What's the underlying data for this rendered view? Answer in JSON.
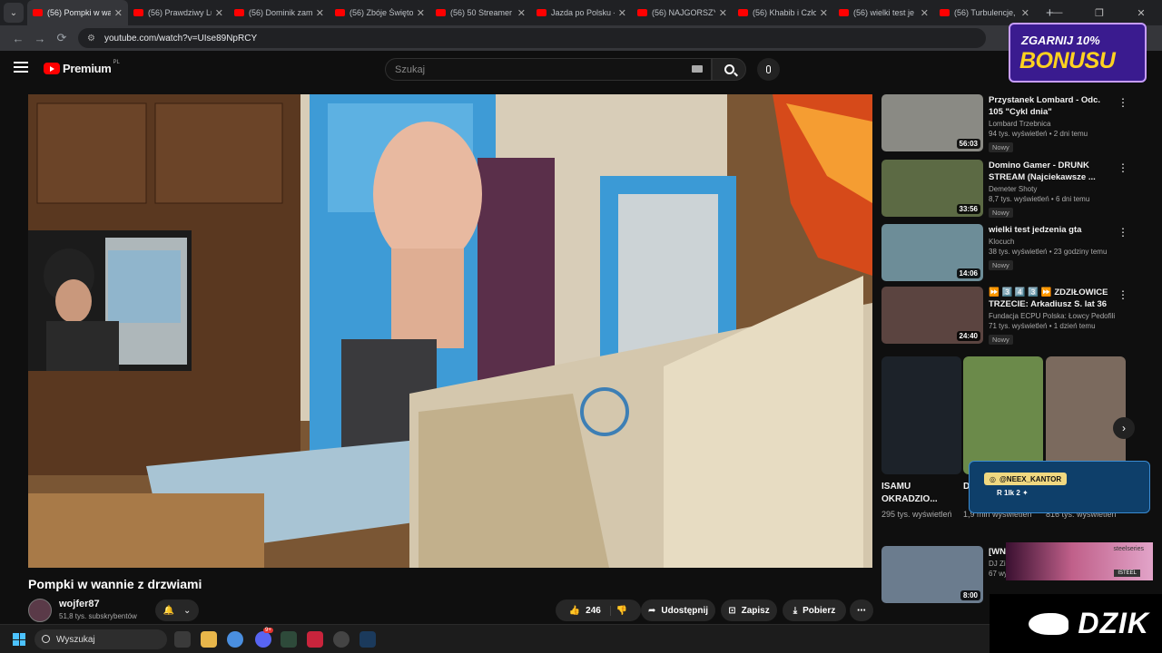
{
  "browser": {
    "tabs": [
      {
        "title": "(56) Pompki w wa",
        "active": true
      },
      {
        "title": "(56) Prawdziwy Lu",
        "active": false
      },
      {
        "title": "(56) Dominik zam",
        "active": false
      },
      {
        "title": "(56) Zbóje Święto",
        "active": false
      },
      {
        "title": "(56) 50 Streamer",
        "active": false
      },
      {
        "title": "Jazda po Polsku -",
        "active": false
      },
      {
        "title": "(56) NAJGORSZY",
        "active": false
      },
      {
        "title": "(56) Khabib i Czło",
        "active": false
      },
      {
        "title": "(56) wielki test je",
        "active": false
      },
      {
        "title": "(56) Turbulencje,",
        "active": false
      }
    ],
    "url": "youtube.com/watch?v=UIse89NpRCY"
  },
  "youtube": {
    "logo_text": "Premium",
    "logo_region": "PL",
    "search_placeholder": "Szukaj"
  },
  "video": {
    "title": "Pompki w wannie z drzwiami",
    "channel": "wojfer87",
    "subscribers": "51,8 tys. subskrybentów",
    "likes": "246",
    "share_label": "Udostępnij",
    "save_label": "Zapisz",
    "download_label": "Pobierz"
  },
  "recommendations": [
    {
      "title": "Przystanek Lombard - Odc. 105 \"Cykl dnia\"",
      "channel": "Lombard Trzebnica",
      "meta": "94 tys. wyświetleń • 2 dni temu",
      "badge": "Nowy",
      "duration": "56:03",
      "color": "#8a8a84"
    },
    {
      "title": "Domino Gamer - DRUNK STREAM (Najciekawsze ...",
      "channel": "Demeter Shoty",
      "meta": "8,7 tys. wyświetleń • 6 dni temu",
      "badge": "Nowy",
      "duration": "33:56",
      "color": "#5c6a44"
    },
    {
      "title": "wielki test jedzenia gta",
      "channel": "Klocuch",
      "meta": "38 tys. wyświetleń • 23 godziny temu",
      "badge": "Nowy",
      "duration": "14:06",
      "color": "#6d8d98"
    },
    {
      "title": "⏩ 3️⃣ 4️⃣ 3️⃣ ⏩ ZDZIŁOWICE TRZECIE: Arkadiusz S. lat 36",
      "channel": "Fundacja ECPU Polska: Łowcy Pedofili",
      "meta": "71 tys. wyświetleń • 1 dzień temu",
      "badge": "Nowy",
      "duration": "24:40",
      "color": "#5b4440"
    },
    {
      "title": "[WN] Tkac...",
      "channel": "DJ Zi...",
      "meta": "67 wyświetleń • 2 dni temu",
      "badge": "",
      "duration": "8:00",
      "color": "#6b7c8e"
    }
  ],
  "shorts": [
    {
      "title": "ISAMU OKRADZIO...",
      "views": "295 tys. wyświetleń",
      "color": "#1c2229"
    },
    {
      "title": "D... k...",
      "views": "1,9 mln wyświetleń",
      "color": "#6b8a4a"
    },
    {
      "title": "",
      "views": "816 tys. wyświetleń",
      "color": "#7b6a5e"
    }
  ],
  "taskbar": {
    "search_placeholder": "Wyszukaj",
    "discord_badge": "9+"
  },
  "stream_overlays": {
    "bonus_line1": "ZGARNIJ 10%",
    "bonus_line2": "BONUSU",
    "instagram_handle": "@NEEX_KANTOR",
    "social_codes": "R 1lk 2 ✦",
    "steelseries_brand": "steelseries",
    "steelseries_code": "ISTEEL",
    "dzik_logo": "DZIK"
  }
}
